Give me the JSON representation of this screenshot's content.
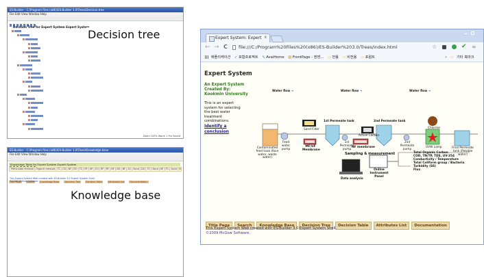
{
  "captions": {
    "decision_tree": "Decision tree",
    "knowledge_base": "Knowledge base"
  },
  "dt_window": {
    "title": "ES-Builder - C:\\Program Files (x86)\\ES-Builder 3.0\\Trees\\Decision.tree",
    "menu": "File  Edit  View  Window  Help",
    "heading": "Decision Tree for Expert System Expert System",
    "status": "Zoom 100%   Word: 1   Pro Saved"
  },
  "kb_window": {
    "title": "ES-Builder - C:\\Program Files (x86)\\ES-Builder 3.0\\Trees\\Knowledge.base",
    "menu": "File  Edit  View  Window  Help",
    "heading": "Knowledge Table for Expert System Expert System",
    "row1": "Particulate removal | Organic removal | TC | CD | NF | DO | TC | RF | NF | CO | RF | RF | NF | DO | NF | SC | Sand | DO | TC | Sand | NF | TC | Sand | NF | TC",
    "tabs": [
      "Title Page",
      "Search",
      "Knowledge Base",
      "Decision Tree",
      "Decision Table",
      "Attributes List",
      "Documentation"
    ],
    "footer1": "This Expert System Web created with ES-Builder 3.0 Expert System Shell.",
    "footer2": "©2009 McGow Software."
  },
  "browser": {
    "tab_title": "Expert System: Expert",
    "tab_close": "x",
    "new_tab": "",
    "url": "file:///C:/Program%20Files%20(x86)/ES-Builder%203.0/Trees/index.html",
    "bookmarks": [
      "애플리케이션",
      "포함프로젝트",
      "AvaiHome",
      "FrontPage - 엔젠...",
      "전용",
      "비전용",
      "포럼트"
    ],
    "bookmarks_more": "기타 북마크",
    "controls": {
      "back": "←",
      "forward": "→",
      "reload": "C",
      "home": "⌂"
    }
  },
  "page": {
    "title": "Expert System",
    "subtitle1": "An Expert System",
    "subtitle2": "Created By:",
    "subtitle3": "Kookmin University",
    "desc": "This is an expert system for selecting the best water treatment combinations.",
    "link": "Identify a conclusion",
    "nav": [
      "Title Page",
      "Search",
      "Knowledge Base",
      "Decision Tree",
      "Decision Table",
      "Attributes List",
      "Documentation"
    ],
    "footer1": "This Expert System Web created with ES-Builder 3.0 Expert System Shell.",
    "footer2": "©2009 McGow Software."
  },
  "diagram": {
    "water_flow": [
      "Water flow",
      "Water flow",
      "Water flow"
    ],
    "permeate_tank_1": "1st Permeate tank",
    "permeate_tank_2": "2nd Permeate tank",
    "sand_filter": "Sand Filter",
    "active_carbon": "Active Carbon",
    "chlorine": "Chlorine",
    "contaminated": "Contaminated feed tank (Rain water, waste water)",
    "feed_pump": "Feed water pump",
    "mf_uf": "MF/UF Membrane",
    "perm_pump_1": "1st Permeate pump",
    "nf_membrane": "NF membrane",
    "perm_pump_2": "2nd Permeate pump",
    "uvw_lamp": "UVW Lamp",
    "final_tank": "Final Permeate tank (Potable water)",
    "sampling": "Sampling & measurement",
    "online_panel": "Online Instrument Panel",
    "data_analysis": "Data analysis",
    "measures": [
      "Total Organic Carbon",
      "COD, TN/TP, TDS, UV-254",
      "Conductivity / Temperature",
      "Total Coliform group / Bacteria",
      "Turbidity (SS)",
      "Flux"
    ]
  },
  "colors": {
    "page_green": "#2e7d1a",
    "link_blue": "#1a1a8a",
    "nav_bg": "#e8d9a8",
    "nav_text": "#6a3f12",
    "tank_orange": "#f2b870",
    "tank_blue": "#9fd3ea",
    "chrome_blue": "#dfe8f7"
  }
}
